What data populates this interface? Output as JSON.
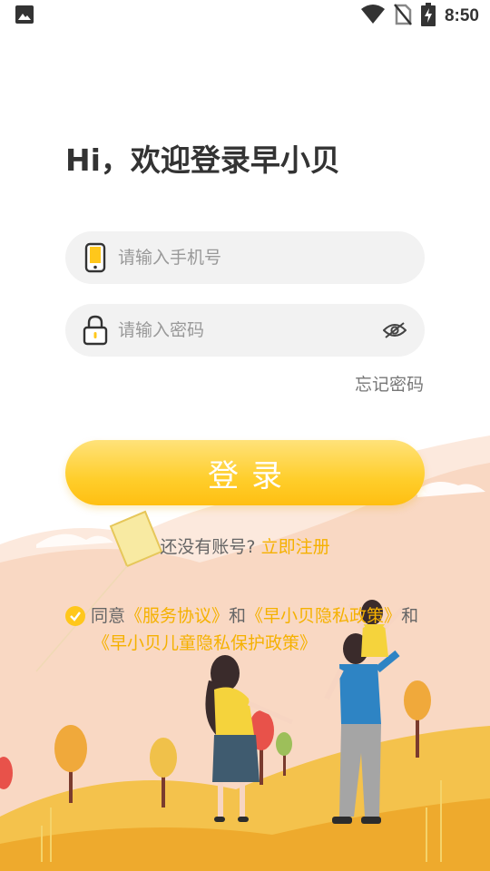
{
  "status_bar": {
    "time": "8:50",
    "icons": [
      "image-icon",
      "wifi-icon",
      "no-sim-icon",
      "battery-charging-icon"
    ]
  },
  "login": {
    "title": "Hi，欢迎登录早小贝",
    "phone_placeholder": "请输入手机号",
    "password_placeholder": "请输入密码",
    "forgot_password": "忘记密码",
    "login_button": "登录",
    "no_account": "还没有账号?",
    "register_link": "立即注册"
  },
  "agreement": {
    "checked": true,
    "agree": "同意",
    "service_agreement": "《服务协议》",
    "and1": "和",
    "privacy_policy": "《早小贝隐私政策》",
    "and2": "和",
    "children_privacy": "《早小贝儿童隐私保护政策》"
  },
  "colors": {
    "accent": "#ffc71b",
    "link": "#f5b100",
    "field_bg": "#f2f2f2",
    "illustration_bg": "#f9dccb",
    "hill": "#f5c04a"
  }
}
